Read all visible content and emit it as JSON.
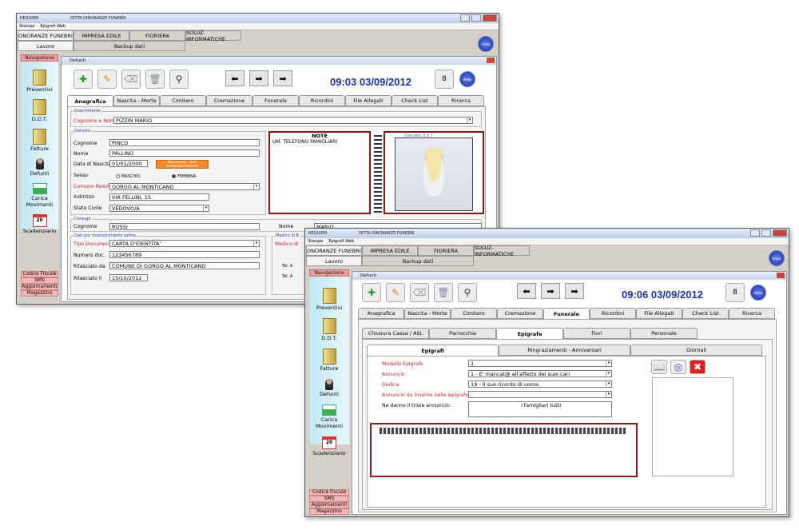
{
  "window1": {
    "title": "REQUIEM",
    "company": "DITTA IONORANZE FUNEBRI",
    "menu": [
      "Stampe",
      "Epigrafi Web"
    ],
    "top_tabs": [
      "ONORANZE FUNEBRI",
      "IMPRESA EDILE",
      "FIORIERA",
      "SOLUZ. INFORMATICHE"
    ],
    "sub_tabs": [
      "Lavoro",
      "Backup dati"
    ],
    "video_label": "Video",
    "sidebar": {
      "header": "Navigazione",
      "items": [
        "Preventivi",
        "D.D.T.",
        "Fatture",
        "Defunti",
        "Carica Movimenti",
        "Scadenziario"
      ],
      "calendar_number": "20",
      "pink_items": [
        "Codice Fiscale",
        "SMS",
        "Aggiornamenti",
        "Magazzino"
      ]
    },
    "inner_title": "Defunti",
    "clock": "09:03 03/09/2012",
    "tabs": [
      "Anagrafica",
      "Nascita - Morte",
      "Cimitero",
      "Cremazione",
      "Funerale",
      "Ricordini",
      "File Allegati",
      "Check List",
      "Ricerca"
    ],
    "selected_tab": "Anagrafica",
    "committente_group": "Committente",
    "cognome_nome_label": "Cognome e Nome",
    "cognome_nome_value": "PIZZIN MARIO",
    "defunto_group": "Defunto",
    "cognome_label": "Cognome",
    "cognome_value": "PINCO",
    "nome_label": "Nome",
    "nome_value": "PALLINO",
    "nascita_label": "Data di Nascita",
    "nascita_value": "01/01/2000",
    "orange_btn": "Desumere i dati automaticamente",
    "sesso_label": "Sesso",
    "maschio": "MASCHIO",
    "femmina": "FEMMINA",
    "comune_label": "Comune Resid.",
    "comune_value": "GORGO AL MONTICANO",
    "indirizzo_label": "Indirizzo",
    "indirizzo_value": "VIA FELLINI, 15",
    "stato_label": "Stato Civile",
    "stato_value": "VEDOVO/A",
    "note_title": "NOTE",
    "note_text": "UM. TELEFONO FAMIGLIARI",
    "photo_label": "Foto dim. 5 X 7",
    "coniuge_group": "Coniuge",
    "coniuge_cognome_label": "Cognome",
    "coniuge_cognome_value": "ROSSI",
    "coniuge_nome_label": "Nome",
    "coniuge_nome_value": "MARIO",
    "doc_group": "Dati per riconoscimento salma",
    "tipo_doc_label": "Tipo Documento",
    "tipo_doc_value": "CARTA D'IDENTITA'",
    "numero_label": "Numero doc.",
    "numero_value": "123456789",
    "rilasciato_label": "Rilasciato da",
    "rilasciato_value": "COMUNE DI GORGO AL MONTICANO",
    "rilasciato_il_label": "Rilasciato il",
    "rilasciato_il_value": "15/10/2012",
    "medico_group": "Medico di B",
    "medico_label": "Medico di",
    "tel_a": "Tel. A",
    "tel_b": "Tel. A"
  },
  "window2": {
    "title": "REQUIEM",
    "company": "DITTA IONORANZE FUNEBRI",
    "menu": [
      "Stampe",
      "Epigrafi Web"
    ],
    "top_tabs": [
      "ONORANZE FUNEBRI",
      "IMPRESA EDILE",
      "FIORIERA",
      "SOLUZ. INFORMATICHE"
    ],
    "sub_tabs": [
      "Lavoro",
      "Backup dati"
    ],
    "video_label": "Video",
    "sidebar": {
      "header": "Navigazione",
      "items": [
        "Preventivi",
        "D.D.T.",
        "Fatture",
        "Defunti",
        "Carica Movimenti",
        "Scadenziario"
      ],
      "calendar_number": "20",
      "pink_items": [
        "Codice Fiscale",
        "SMS",
        "Aggiornamenti",
        "Magazzino"
      ]
    },
    "inner_title": "Defunti",
    "clock": "09:06 03/09/2012",
    "tabs": [
      "Anagrafica",
      "Nascita - Morte",
      "Cimitero",
      "Cremazione",
      "Funerale",
      "Ricordini",
      "File Allegati",
      "Check List",
      "Ricerca"
    ],
    "selected_tab": "Funerale",
    "sub_tabs2": [
      "Chiusura Cassa / ASL",
      "Parrocchia",
      "Epigrafe",
      "Fiori",
      "Personale"
    ],
    "sub_tabs3": [
      "Epigrafi",
      "Ringraziamenti - Anniversari",
      "Giornali"
    ],
    "modello_label": "Modello Epigrafe",
    "modello_value": "1",
    "annuncio_label": "Annuncio",
    "annuncio_value": "1 - E' mancat@ all'affetto dei suoi cari",
    "dedica_label": "Dedica",
    "dedica_value": "19 - Il suo ricordo di uomo",
    "annuncio_ep_label": "Annuncio da inserire nelle epigrafe",
    "annuncio_ep_value": "",
    "ne_danno_label": "Ne danno il triste annuncio:",
    "ne_danno_value": "i famigliari tutti"
  }
}
